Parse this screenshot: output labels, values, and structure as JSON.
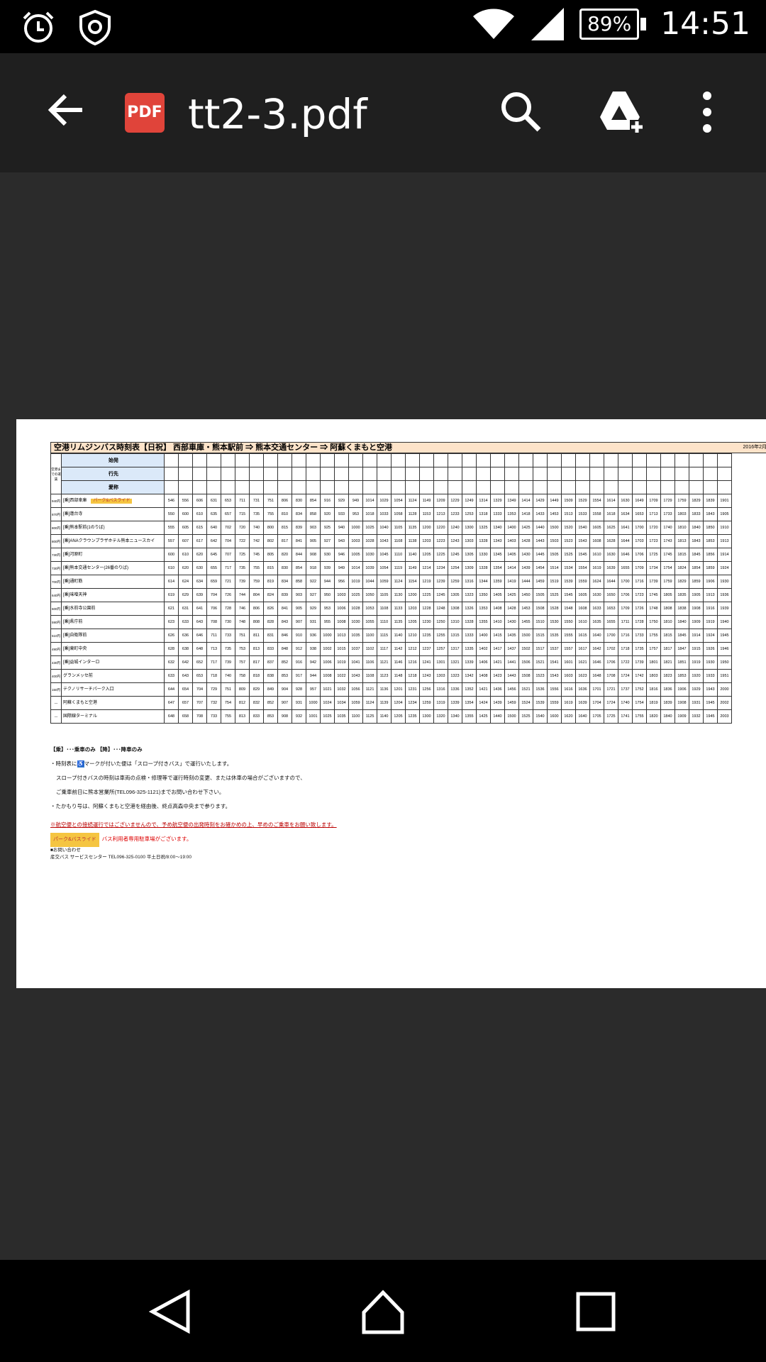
{
  "status_bar": {
    "time": "14:51",
    "battery": "89%"
  },
  "app_bar": {
    "title": "tt2-3.pdf",
    "file_badge": "PDF"
  },
  "document": {
    "title": "空港リムジンバス時刻表【日祝】 西部車庫・熊本駅前 ⇒ 熊本交通センター ⇒ 阿蘇くまもと空港",
    "date": "2016年2月",
    "fare_header": "空港までの運賃",
    "row_labels": {
      "origin": "始発",
      "destination": "行先",
      "nickname": "愛称"
    },
    "park_tag": "パーク&バスライド",
    "stops": [
      {
        "fare": "940円",
        "name": "[乗]西部車庫",
        "times": [
          "546",
          "556",
          "606",
          "631",
          "653",
          "711",
          "731",
          "751",
          "806",
          "830",
          "854",
          "916",
          "929",
          "949",
          "1014",
          "1029",
          "1054",
          "1124",
          "1149",
          "1209",
          "1229",
          "1249",
          "1314",
          "1329",
          "1349",
          "1414",
          "1429",
          "1449",
          "1509",
          "1529",
          "1554",
          "1614",
          "1630",
          "1649",
          "1709",
          "1729",
          "1759",
          "1829",
          "1839",
          "1901"
        ]
      },
      {
        "fare": "870円",
        "name": "[乗]蓮台寺",
        "times": [
          "550",
          "600",
          "610",
          "635",
          "657",
          "715",
          "735",
          "755",
          "810",
          "834",
          "858",
          "920",
          "933",
          "953",
          "1018",
          "1033",
          "1058",
          "1128",
          "1153",
          "1213",
          "1233",
          "1253",
          "1318",
          "1333",
          "1353",
          "1418",
          "1433",
          "1453",
          "1513",
          "1533",
          "1558",
          "1618",
          "1634",
          "1653",
          "1713",
          "1733",
          "1803",
          "1833",
          "1843",
          "1905"
        ]
      },
      {
        "fare": "800円",
        "name": "[乗]熊本駅前(1のりば)",
        "times": [
          "555",
          "605",
          "615",
          "640",
          "702",
          "720",
          "740",
          "800",
          "815",
          "839",
          "903",
          "925",
          "940",
          "1000",
          "1025",
          "1040",
          "1105",
          "1135",
          "1200",
          "1220",
          "1240",
          "1300",
          "1325",
          "1340",
          "1400",
          "1425",
          "1440",
          "1500",
          "1520",
          "1540",
          "1605",
          "1625",
          "1641",
          "1700",
          "1720",
          "1740",
          "1810",
          "1840",
          "1850",
          "1910"
        ]
      },
      {
        "fare": "800円",
        "name": "[乗]ANAクラウンプラザホテル熊本ニュースカイ",
        "times": [
          "557",
          "607",
          "617",
          "642",
          "704",
          "722",
          "742",
          "802",
          "817",
          "841",
          "905",
          "927",
          "943",
          "1003",
          "1028",
          "1043",
          "1108",
          "1138",
          "1203",
          "1223",
          "1243",
          "1303",
          "1328",
          "1343",
          "1403",
          "1428",
          "1443",
          "1503",
          "1523",
          "1543",
          "1608",
          "1628",
          "1644",
          "1703",
          "1723",
          "1743",
          "1813",
          "1843",
          "1853",
          "1913"
        ]
      },
      {
        "fare": "730円",
        "name": "[乗]河原町",
        "times": [
          "600",
          "610",
          "620",
          "645",
          "707",
          "725",
          "745",
          "805",
          "820",
          "844",
          "908",
          "930",
          "946",
          "1005",
          "1030",
          "1045",
          "1110",
          "1140",
          "1205",
          "1225",
          "1245",
          "1305",
          "1330",
          "1345",
          "1405",
          "1430",
          "1445",
          "1505",
          "1525",
          "1545",
          "1610",
          "1630",
          "1646",
          "1706",
          "1725",
          "1745",
          "1815",
          "1845",
          "1856",
          "1914"
        ]
      },
      {
        "fare": "730円",
        "name": "[乗]熊本交通センター(26番のりば)",
        "times": [
          "610",
          "620",
          "630",
          "655",
          "717",
          "735",
          "755",
          "815",
          "830",
          "854",
          "918",
          "939",
          "949",
          "1014",
          "1039",
          "1054",
          "1119",
          "1149",
          "1214",
          "1234",
          "1254",
          "1309",
          "1328",
          "1354",
          "1414",
          "1439",
          "1454",
          "1514",
          "1534",
          "1554",
          "1619",
          "1639",
          "1655",
          "1709",
          "1734",
          "1754",
          "1824",
          "1854",
          "1859",
          "1924"
        ]
      },
      {
        "fare": "700円",
        "name": "[乗]通町筋",
        "times": [
          "614",
          "624",
          "634",
          "659",
          "721",
          "739",
          "759",
          "819",
          "834",
          "858",
          "922",
          "944",
          "956",
          "1019",
          "1044",
          "1059",
          "1124",
          "1154",
          "1219",
          "1239",
          "1259",
          "1316",
          "1344",
          "1359",
          "1419",
          "1444",
          "1459",
          "1519",
          "1539",
          "1559",
          "1624",
          "1644",
          "1700",
          "1716",
          "1739",
          "1759",
          "1829",
          "1859",
          "1906",
          "1930"
        ]
      },
      {
        "fare": "640円",
        "name": "[乗]味噌天神",
        "times": [
          "619",
          "629",
          "639",
          "704",
          "726",
          "744",
          "804",
          "824",
          "839",
          "903",
          "927",
          "950",
          "1003",
          "1025",
          "1050",
          "1105",
          "1130",
          "1200",
          "1225",
          "1245",
          "1305",
          "1323",
          "1350",
          "1405",
          "1425",
          "1450",
          "1505",
          "1525",
          "1545",
          "1605",
          "1630",
          "1650",
          "1706",
          "1723",
          "1745",
          "1805",
          "1835",
          "1905",
          "1913",
          "1936"
        ]
      },
      {
        "fare": "600円",
        "name": "[乗]水前寺公園前",
        "times": [
          "621",
          "631",
          "641",
          "706",
          "728",
          "746",
          "806",
          "826",
          "841",
          "905",
          "929",
          "953",
          "1006",
          "1028",
          "1053",
          "1108",
          "1133",
          "1203",
          "1228",
          "1248",
          "1308",
          "1326",
          "1353",
          "1408",
          "1428",
          "1453",
          "1508",
          "1528",
          "1548",
          "1608",
          "1633",
          "1653",
          "1709",
          "1726",
          "1748",
          "1808",
          "1838",
          "1908",
          "1916",
          "1939"
        ]
      },
      {
        "fare": "590円",
        "name": "[乗]県庁前",
        "times": [
          "623",
          "633",
          "643",
          "708",
          "730",
          "748",
          "808",
          "828",
          "843",
          "907",
          "931",
          "955",
          "1008",
          "1030",
          "1055",
          "1110",
          "1135",
          "1205",
          "1230",
          "1250",
          "1310",
          "1328",
          "1355",
          "1410",
          "1430",
          "1455",
          "1510",
          "1530",
          "1550",
          "1610",
          "1635",
          "1655",
          "1711",
          "1728",
          "1750",
          "1810",
          "1840",
          "1909",
          "1919",
          "1940"
        ]
      },
      {
        "fare": "510円",
        "name": "[乗]自衛隊前",
        "times": [
          "626",
          "636",
          "646",
          "711",
          "733",
          "751",
          "811",
          "831",
          "846",
          "910",
          "936",
          "1000",
          "1013",
          "1035",
          "1100",
          "1115",
          "1140",
          "1210",
          "1235",
          "1255",
          "1315",
          "1333",
          "1400",
          "1415",
          "1435",
          "1500",
          "1515",
          "1535",
          "1555",
          "1615",
          "1640",
          "1700",
          "1716",
          "1733",
          "1755",
          "1815",
          "1845",
          "1914",
          "1924",
          "1945"
        ]
      },
      {
        "fare": "490円",
        "name": "[乗]東町中央",
        "times": [
          "628",
          "638",
          "648",
          "713",
          "735",
          "753",
          "813",
          "833",
          "848",
          "912",
          "938",
          "1002",
          "1015",
          "1037",
          "1102",
          "1117",
          "1142",
          "1212",
          "1237",
          "1257",
          "1317",
          "1335",
          "1402",
          "1417",
          "1437",
          "1502",
          "1517",
          "1537",
          "1557",
          "1617",
          "1642",
          "1702",
          "1718",
          "1735",
          "1757",
          "1817",
          "1847",
          "1915",
          "1926",
          "1946"
        ]
      },
      {
        "fare": "430円",
        "name": "[乗]益城インターロ",
        "times": [
          "632",
          "642",
          "652",
          "717",
          "739",
          "757",
          "817",
          "837",
          "852",
          "916",
          "942",
          "1006",
          "1019",
          "1041",
          "1106",
          "1121",
          "1146",
          "1216",
          "1241",
          "1301",
          "1321",
          "1339",
          "1406",
          "1421",
          "1441",
          "1506",
          "1521",
          "1541",
          "1601",
          "1621",
          "1646",
          "1706",
          "1722",
          "1739",
          "1801",
          "1821",
          "1851",
          "1919",
          "1930",
          "1950"
        ]
      },
      {
        "fare": "400円",
        "name": "グランメッセ前",
        "times": [
          "633",
          "643",
          "653",
          "718",
          "740",
          "758",
          "818",
          "838",
          "853",
          "917",
          "944",
          "1008",
          "1022",
          "1043",
          "1108",
          "1123",
          "1148",
          "1218",
          "1243",
          "1303",
          "1323",
          "1342",
          "1408",
          "1423",
          "1443",
          "1508",
          "1523",
          "1543",
          "1603",
          "1623",
          "1648",
          "1708",
          "1724",
          "1742",
          "1803",
          "1823",
          "1853",
          "1920",
          "1933",
          "1951"
        ]
      },
      {
        "fare": "150円",
        "name": "テクノリサーチパーク入口",
        "times": [
          "644",
          "654",
          "704",
          "729",
          "751",
          "809",
          "829",
          "849",
          "904",
          "928",
          "957",
          "1021",
          "1032",
          "1056",
          "1121",
          "1136",
          "1201",
          "1231",
          "1256",
          "1316",
          "1336",
          "1352",
          "1421",
          "1436",
          "1456",
          "1521",
          "1536",
          "1556",
          "1616",
          "1636",
          "1701",
          "1721",
          "1737",
          "1752",
          "1816",
          "1836",
          "1906",
          "1929",
          "1943",
          "2000"
        ]
      },
      {
        "fare": "—",
        "name": "阿蘇くまもと空港",
        "times": [
          "647",
          "657",
          "707",
          "732",
          "754",
          "812",
          "832",
          "852",
          "907",
          "931",
          "1000",
          "1024",
          "1034",
          "1059",
          "1124",
          "1139",
          "1204",
          "1234",
          "1259",
          "1319",
          "1339",
          "1354",
          "1424",
          "1439",
          "1459",
          "1524",
          "1539",
          "1559",
          "1619",
          "1639",
          "1704",
          "1724",
          "1740",
          "1754",
          "1819",
          "1839",
          "1908",
          "1931",
          "1945",
          "2002"
        ]
      },
      {
        "fare": "—",
        "name": "国際線ターミナル",
        "times": [
          "648",
          "658",
          "708",
          "733",
          "755",
          "813",
          "833",
          "853",
          "908",
          "932",
          "1001",
          "1025",
          "1035",
          "1100",
          "1125",
          "1140",
          "1205",
          "1235",
          "1300",
          "1320",
          "1340",
          "1355",
          "1425",
          "1440",
          "1500",
          "1525",
          "1540",
          "1600",
          "1620",
          "1640",
          "1705",
          "1725",
          "1741",
          "1755",
          "1820",
          "1840",
          "1909",
          "1932",
          "1945",
          "2003"
        ]
      }
    ],
    "notes": {
      "legend": "【乗】･･･乗車のみ 【降】･･･降車のみ",
      "wheelchair_prefix": "・時刻表に",
      "wheelchair_suffix": "マークが付いた便は「スロープ付きバス」で運行いたします。",
      "slope_note": "スロープ付きバスの時刻は車両の点検・修理等で運行時刻の変更、または休車の場合がございますので、",
      "contact_note": "ご乗車前日に熊本営業所(TEL096-325-1121)までお問い合わせ下さい。",
      "takamori_note": "・たかもり号は、阿蘇くまもと空港を経由後、終点高森中央まで参ります。",
      "flight_warning": "※航空便との接続運行ではございませんので、予め航空便の出発時刻をお確かめの上、早めのご乗車をお願い致します。",
      "parking_note": "バス利用者専用駐車場がございます。",
      "inquiry_label": "■お問い合わせ",
      "inquiry_detail": "産交バス サービスセンター TEL096-325-0100 平土日祝/8:00～19:00"
    }
  },
  "colors": {
    "accent_pdf": "#e0443a",
    "header_cell": "#dbe9f9",
    "title_band": "#fde3c9"
  }
}
